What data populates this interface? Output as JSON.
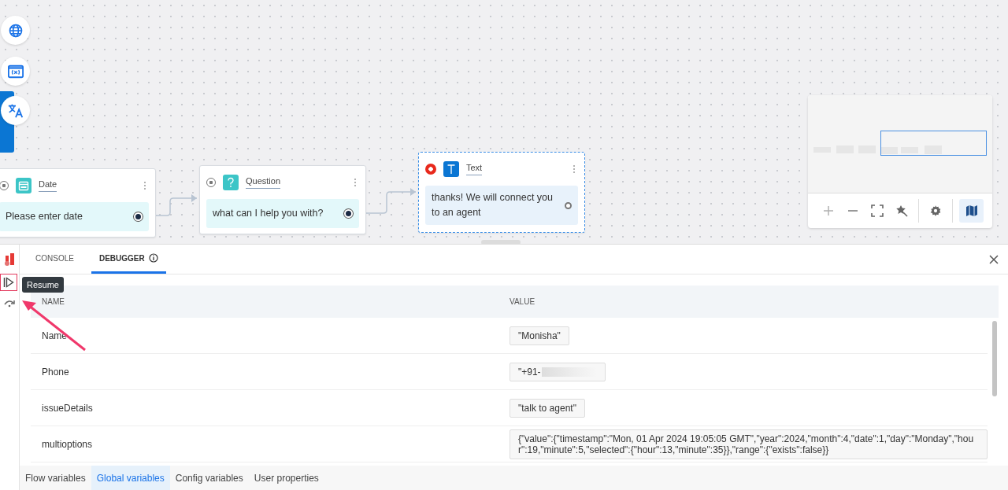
{
  "canvas_tools": [
    {
      "kind": "globe"
    },
    {
      "kind": "variables"
    },
    {
      "kind": "translate"
    }
  ],
  "nodes": [
    {
      "kind": "date",
      "title": "Date",
      "message": "Please enter date",
      "selected": false,
      "breakpoint": false
    },
    {
      "kind": "question",
      "title": "Question",
      "message": "what can I help you with?",
      "selected": false,
      "breakpoint": false
    },
    {
      "kind": "text",
      "title": "Text",
      "message": "thanks! We will connect you to an agent",
      "selected": true,
      "breakpoint": true
    }
  ],
  "minimap": {
    "controls": [
      {
        "kind": "zoom-in"
      },
      {
        "kind": "zoom-out"
      },
      {
        "kind": "fit"
      },
      {
        "kind": "magic"
      },
      {
        "kind": "settings"
      },
      {
        "kind": "map",
        "on": true
      }
    ]
  },
  "debug_rail": {
    "tooltip": "Resume"
  },
  "panel_tabs": [
    {
      "label": "CONSOLE",
      "selected": false,
      "info": false
    },
    {
      "label": "DEBUGGER",
      "selected": true,
      "info": true
    }
  ],
  "table": {
    "columns": [
      "NAME",
      "VALUE"
    ],
    "rows": [
      {
        "name": "Name",
        "value": "\"Monisha\"",
        "masked": false
      },
      {
        "name": "Phone",
        "value": "\"+91-",
        "masked": true
      },
      {
        "name": "issueDetails",
        "value": "\"talk to agent\"",
        "masked": false
      },
      {
        "name": "multioptions",
        "value": "{\"value\":{\"timestamp\":\"Mon, 01 Apr 2024 19:05:05 GMT\",\"year\":2024,\"month\":4,\"date\":1,\"day\":\"Monday\",\"hour\":19,\"minute\":5,\"selected\":{\"hour\":13,\"minute\":35}},\"range\":{\"exists\":false}}",
        "masked": false
      }
    ]
  },
  "bottom_tabs": [
    {
      "label": "Flow variables",
      "selected": false
    },
    {
      "label": "Global variables",
      "selected": true
    },
    {
      "label": "Config variables",
      "selected": false
    },
    {
      "label": "User properties",
      "selected": false
    }
  ]
}
